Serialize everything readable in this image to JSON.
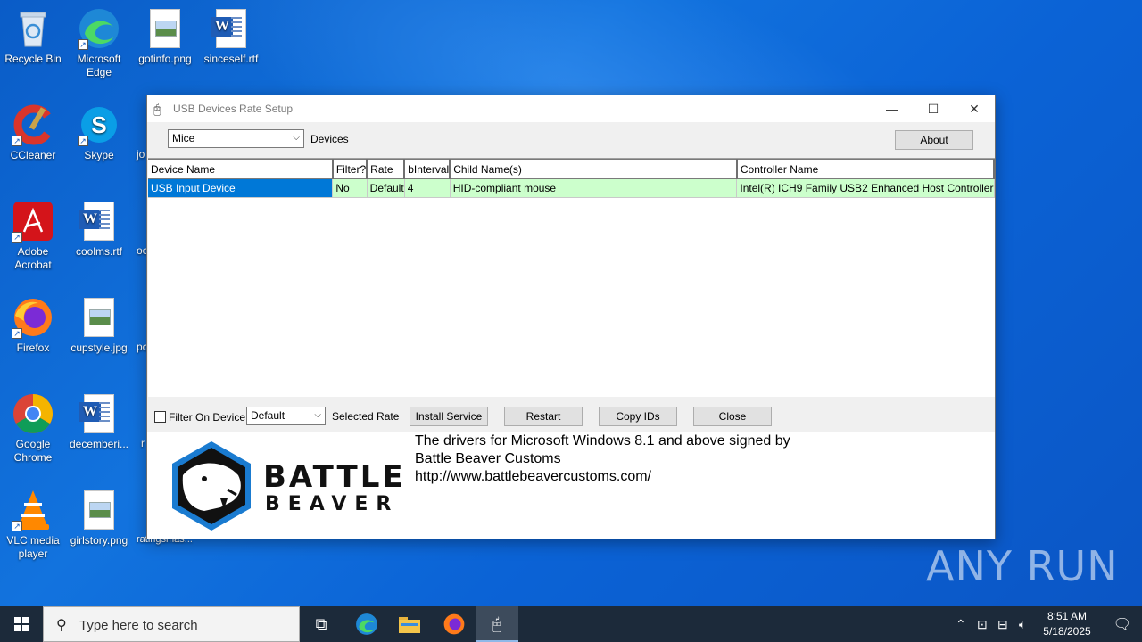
{
  "desktop": {
    "icons": [
      {
        "label": "Recycle Bin"
      },
      {
        "label": "Microsoft Edge"
      },
      {
        "label": "gotinfo.png"
      },
      {
        "label": "sinceself.rtf"
      },
      {
        "label": "CCleaner"
      },
      {
        "label": "Skype"
      },
      {
        "label": "Adobe Acrobat"
      },
      {
        "label": "coolms.rtf"
      },
      {
        "label": "Firefox"
      },
      {
        "label": "cupstyle.jpg"
      },
      {
        "label": "Google Chrome"
      },
      {
        "label": "decemberi..."
      },
      {
        "label": "VLC media player"
      },
      {
        "label": "girlstory.png"
      },
      {
        "label": "ratingsmas..."
      }
    ],
    "partial_labels": [
      "jo",
      "oc",
      "pc",
      "r"
    ]
  },
  "window": {
    "title": "USB Devices Rate Setup",
    "device_type_select": "Mice",
    "devices_label": "Devices",
    "about_button": "About",
    "table": {
      "headers": [
        "Device Name",
        "Filter?",
        "Rate",
        "bInterval",
        "Child Name(s)",
        "Controller Name"
      ],
      "rows": [
        [
          "USB Input Device",
          "No",
          "Default",
          "4",
          "HID-compliant mouse",
          "Intel(R) ICH9 Family USB2 Enhanced Host Controller"
        ]
      ]
    },
    "filter_on_device_label": "Filter On Device",
    "rate_select": "Default",
    "selected_rate_label": "Selected Rate",
    "install_service_button": "Install Service",
    "restart_button": "Restart",
    "copy_ids_button": "Copy IDs",
    "close_button": "Close",
    "brand_line1": "BATTLE",
    "brand_line2": "BEAVER",
    "info_line1": "The drivers for Microsoft Windows 8.1 and above signed by",
    "info_line2": "Battle Beaver Customs",
    "info_line3": "http://www.battlebeavercustoms.com/"
  },
  "taskbar": {
    "search_placeholder": "Type here to search",
    "time": "8:51 AM",
    "date": "5/18/2025"
  },
  "watermark": "ANY RUN",
  "colors": {
    "selection": "#0078d7",
    "row_bg": "#ccffcc",
    "taskbar": "#1c2a3a"
  }
}
